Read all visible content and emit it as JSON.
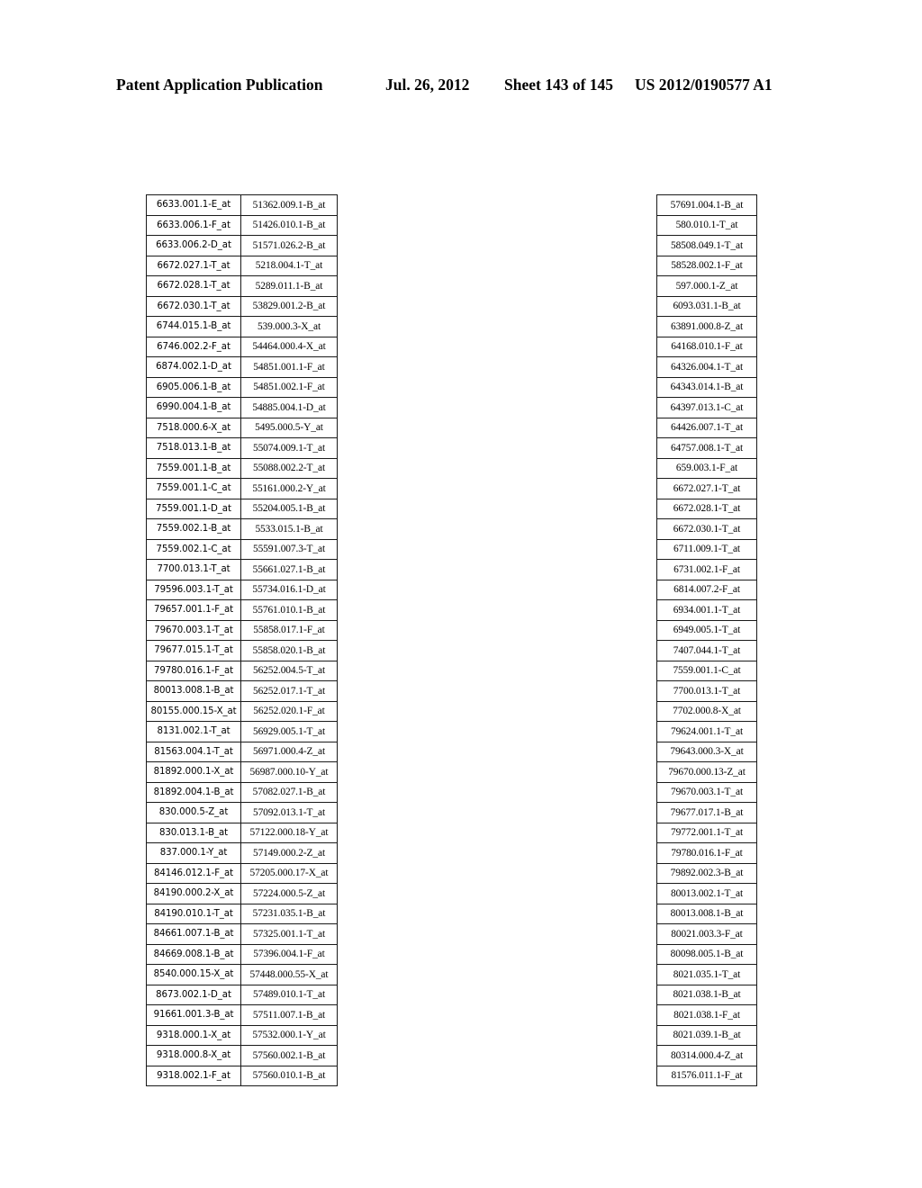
{
  "header": {
    "publication": "Patent Application Publication",
    "date": "Jul. 26, 2012",
    "sheet": "Sheet 143 of 145",
    "patent_number": "US 2012/0190577 A1"
  },
  "tables": {
    "left": {
      "column_1": [
        "6633.001.1-E_at",
        "6633.006.1-F_at",
        "6633.006.2-D_at",
        "6672.027.1-T_at",
        "6672.028.1-T_at",
        "6672.030.1-T_at",
        "6744.015.1-B_at",
        "6746.002.2-F_at",
        "6874.002.1-D_at",
        "6905.006.1-B_at",
        "6990.004.1-B_at",
        "7518.000.6-X_at",
        "7518.013.1-B_at",
        "7559.001.1-B_at",
        "7559.001.1-C_at",
        "7559.001.1-D_at",
        "7559.002.1-B_at",
        "7559.002.1-C_at",
        "7700.013.1-T_at",
        "79596.003.1-T_at",
        "79657.001.1-F_at",
        "79670.003.1-T_at",
        "79677.015.1-T_at",
        "79780.016.1-F_at",
        "80013.008.1-B_at",
        "80155.000.15-X_at",
        "8131.002.1-T_at",
        "81563.004.1-T_at",
        "81892.000.1-X_at",
        "81892.004.1-B_at",
        "830.000.5-Z_at",
        "830.013.1-B_at",
        "837.000.1-Y_at",
        "84146.012.1-F_at",
        "84190.000.2-X_at",
        "84190.010.1-T_at",
        "84661.007.1-B_at",
        "84669.008.1-B_at",
        "8540.000.15-X_at",
        "8673.002.1-D_at",
        "91661.001.3-B_at",
        "9318.000.1-X_at",
        "9318.000.8-X_at",
        "9318.002.1-F_at"
      ],
      "column_2": [
        "51362.009.1-B_at",
        "51426.010.1-B_at",
        "51571.026.2-B_at",
        "5218.004.1-T_at",
        "5289.011.1-B_at",
        "53829.001.2-B_at",
        "539.000.3-X_at",
        "54464.000.4-X_at",
        "54851.001.1-F_at",
        "54851.002.1-F_at",
        "54885.004.1-D_at",
        "5495.000.5-Y_at",
        "55074.009.1-T_at",
        "55088.002.2-T_at",
        "55161.000.2-Y_at",
        "55204.005.1-B_at",
        "5533.015.1-B_at",
        "55591.007.3-T_at",
        "55661.027.1-B_at",
        "55734.016.1-D_at",
        "55761.010.1-B_at",
        "55858.017.1-F_at",
        "55858.020.1-B_at",
        "56252.004.5-T_at",
        "56252.017.1-T_at",
        "56252.020.1-F_at",
        "56929.005.1-T_at",
        "56971.000.4-Z_at",
        "56987.000.10-Y_at",
        "57082.027.1-B_at",
        "57092.013.1-T_at",
        "57122.000.18-Y_at",
        "57149.000.2-Z_at",
        "57205.000.17-X_at",
        "57224.000.5-Z_at",
        "57231.035.1-B_at",
        "57325.001.1-T_at",
        "57396.004.1-F_at",
        "57448.000.55-X_at",
        "57489.010.1-T_at",
        "57511.007.1-B_at",
        "57532.000.1-Y_at",
        "57560.002.1-B_at",
        "57560.010.1-B_at"
      ]
    },
    "right": {
      "column_1": [
        "57691.004.1-B_at",
        "580.010.1-T_at",
        "58508.049.1-T_at",
        "58528.002.1-F_at",
        "597.000.1-Z_at",
        "6093.031.1-B_at",
        "63891.000.8-Z_at",
        "64168.010.1-F_at",
        "64326.004.1-T_at",
        "64343.014.1-B_at",
        "64397.013.1-C_at",
        "64426.007.1-T_at",
        "64757.008.1-T_at",
        "659.003.1-F_at",
        "6672.027.1-T_at",
        "6672.028.1-T_at",
        "6672.030.1-T_at",
        "6711.009.1-T_at",
        "6731.002.1-F_at",
        "6814.007.2-F_at",
        "6934.001.1-T_at",
        "6949.005.1-T_at",
        "7407.044.1-T_at",
        "7559.001.1-C_at",
        "7700.013.1-T_at",
        "7702.000.8-X_at",
        "79624.001.1-T_at",
        "79643.000.3-X_at",
        "79670.000.13-Z_at",
        "79670.003.1-T_at",
        "79677.017.1-B_at",
        "79772.001.1-T_at",
        "79780.016.1-F_at",
        "79892.002.3-B_at",
        "80013.002.1-T_at",
        "80013.008.1-B_at",
        "80021.003.3-F_at",
        "80098.005.1-B_at",
        "8021.035.1-T_at",
        "8021.038.1-B_at",
        "8021.038.1-F_at",
        "8021.039.1-B_at",
        "80314.000.4-Z_at",
        "81576.011.1-F_at"
      ]
    }
  }
}
